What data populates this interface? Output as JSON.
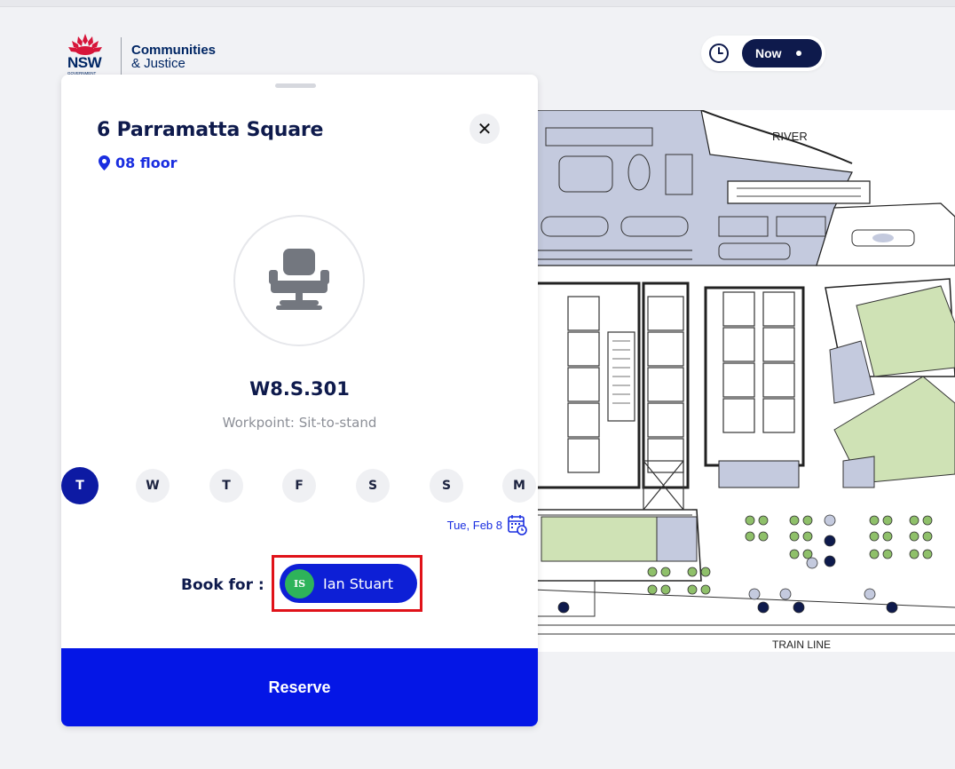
{
  "brand": {
    "nsw": "NSW",
    "government": "GOVERNMENT",
    "dept_line1": "Communities",
    "dept_line2": "& Justice"
  },
  "time_control": {
    "icon": "clock-icon",
    "selected": "Now"
  },
  "panel": {
    "building": "6 Parramatta Square",
    "floor": "08 floor",
    "seat_id": "W8.S.301",
    "seat_type": "Workpoint: Sit-to-stand",
    "days": [
      {
        "label": "T",
        "active": true
      },
      {
        "label": "W",
        "active": false
      },
      {
        "label": "T",
        "active": false
      },
      {
        "label": "F",
        "active": false
      },
      {
        "label": "S",
        "active": false
      },
      {
        "label": "S",
        "active": false
      },
      {
        "label": "M",
        "active": false
      }
    ],
    "date": "Tue, Feb 8",
    "book_for_label": "Book for :",
    "user": {
      "initials": "IS",
      "name": "Ian Stuart"
    },
    "reserve_label": "Reserve"
  },
  "map": {
    "label_top": "RIVER",
    "label_bottom": "TRAIN LINE"
  },
  "colors": {
    "navy": "#0e1a4c",
    "accent_blue": "#0416e6",
    "highlight_red": "#e01219",
    "avatar_green": "#2eb35a",
    "zone_blue": "#c4cade",
    "zone_green": "#cfe2b5"
  }
}
